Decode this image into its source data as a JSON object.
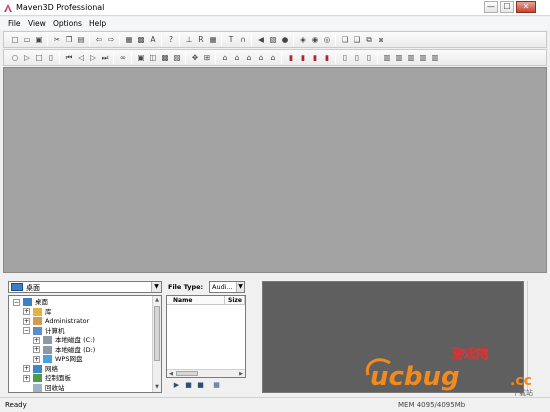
{
  "window": {
    "title": "Maven3D Professional",
    "controls": {
      "minimize": "—",
      "maximize": "☐",
      "close": "✕"
    }
  },
  "menu": [
    "File",
    "View",
    "Options",
    "Help"
  ],
  "toolbar1_icons": [
    "new-file-icon",
    "open-folder-icon",
    "save-icon",
    "cut-icon",
    "copy-icon",
    "paste-icon",
    "undo-icon",
    "redo-icon",
    "layout-icon",
    "material-icon",
    "font-icon",
    "help-icon",
    "align-icon",
    "render-icon",
    "grid-icon",
    "text-icon",
    "headphones-icon",
    "speaker-icon",
    "object-icon",
    "sphere-icon",
    "cube-icon",
    "cylinder-icon",
    "torus-icon",
    "group-icon",
    "ungroup-icon",
    "link-icon",
    "unlink-icon"
  ],
  "toolbar2_icons": [
    "record-icon",
    "play-icon",
    "stop-icon",
    "pause-icon",
    "rewind-icon",
    "step-back-icon",
    "step-forward-icon",
    "fast-forward-icon",
    "loop-icon",
    "frame-icon",
    "keyframe-icon",
    "camera-icon",
    "light-icon",
    "move-icon",
    "snap-icon",
    "house-icon",
    "house-2-icon",
    "house-3-icon",
    "house-4-icon",
    "house-5-icon",
    "book-red-icon",
    "book-red-2-icon",
    "book-red-3-icon",
    "book-red-4-icon",
    "doc-icon",
    "doc-2-icon",
    "doc-3-icon",
    "view-icon",
    "view-2-icon",
    "view-3-icon",
    "view-4-icon",
    "view-5-icon"
  ],
  "explorer": {
    "location": "桌面",
    "tree": [
      {
        "label": "桌面",
        "level": 0,
        "expander": "−",
        "icon": "desktop-icon"
      },
      {
        "label": "库",
        "level": 1,
        "expander": "+",
        "icon": "library-icon"
      },
      {
        "label": "Administrator",
        "level": 1,
        "expander": "+",
        "icon": "user-icon"
      },
      {
        "label": "计算机",
        "level": 1,
        "expander": "−",
        "icon": "computer-icon"
      },
      {
        "label": "本地磁盘 (C:)",
        "level": 2,
        "expander": "+",
        "icon": "drive-icon"
      },
      {
        "label": "本地磁盘 (D:)",
        "level": 2,
        "expander": "+",
        "icon": "drive-icon"
      },
      {
        "label": "WPS网盘",
        "level": 2,
        "expander": "+",
        "icon": "cloud-icon"
      },
      {
        "label": "网络",
        "level": 1,
        "expander": "+",
        "icon": "network-icon"
      },
      {
        "label": "控制面板",
        "level": 1,
        "expander": "+",
        "icon": "control-panel-icon"
      },
      {
        "label": "回收站",
        "level": 1,
        "expander": "",
        "icon": "recycle-bin-icon"
      }
    ]
  },
  "files": {
    "type_label": "File Type:",
    "type_value": "Audi...",
    "columns": [
      "Name",
      "Size"
    ]
  },
  "status": {
    "text": "Ready",
    "memory": "MEM 4095/4095Mb"
  },
  "watermark": {
    "main": "ucbug",
    "suffix": ".cc",
    "top_text": "游戏网",
    "bottom_text": "下载站"
  },
  "colors": {
    "viewport": "#a3a3a3",
    "preview": "#5f5f5f",
    "watermark_orange": "#f28a1e"
  }
}
